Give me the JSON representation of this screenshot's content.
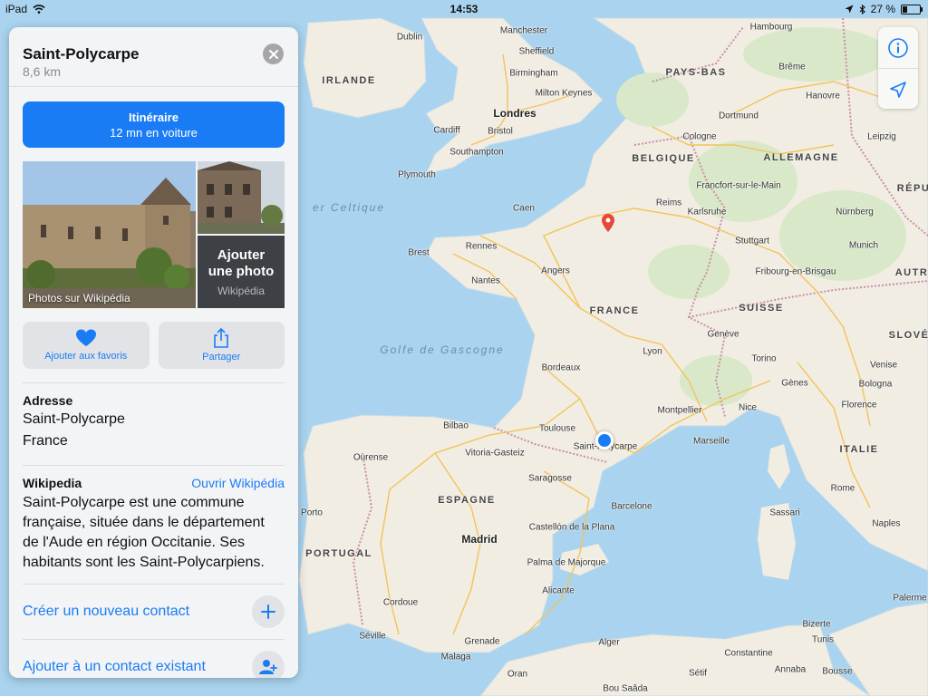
{
  "status_bar": {
    "device": "iPad",
    "time": "14:53",
    "battery_text": "27 %",
    "battery_level": 0.27
  },
  "map": {
    "seas": [
      "er Celtique",
      "Golfe de Gascogne"
    ],
    "countries": [
      "IRLANDE",
      "PAYS-BAS",
      "BELGIQUE",
      "ALLEMAGNE",
      "FRANCE",
      "SUISSE",
      "ESPAGNE",
      "PORTUGAL",
      "ITALIE",
      "RÉPU",
      "AUTR",
      "SLOVÉ"
    ],
    "cities": [
      "Dublin",
      "Manchester",
      "Sheffield",
      "Birmingham",
      "Milton Keynes",
      "Londres",
      "Cardiff",
      "Bristol",
      "Southampton",
      "Plymouth",
      "Hambourg",
      "Brême",
      "Hanovre",
      "Dortmund",
      "Leipzig",
      "Cologne",
      "Francfort-sur-le-Main",
      "Nürnberg",
      "Karlsruhe",
      "Stuttgart",
      "Munich",
      "Fribourg-en-Brisgau",
      "Caen",
      "Reims",
      "Rennes",
      "Brest",
      "Angers",
      "Nantes",
      "Genève",
      "Lyon",
      "Bordeaux",
      "Torino",
      "Gènes",
      "Venise",
      "Bologna",
      "Florence",
      "Nice",
      "Montpellier",
      "Marseille",
      "Toulouse",
      "Saint-Polycarpe",
      "Bilbao",
      "Vitoria-Gasteiz",
      "Ourense",
      "Saragosse",
      "Barcelone",
      "Porto",
      "Madrid",
      "Castellón de la Plana",
      "Palma de Majorque",
      "Sassari",
      "Rome",
      "Naples",
      "Alicante",
      "Cordoue",
      "Séville",
      "Malaga",
      "Grenade",
      "Alger",
      "Constantine",
      "Bizerte",
      "Tunis",
      "Palerme",
      "Annaba",
      "Sétif",
      "Bousse",
      "Oran",
      "Bou Saâda"
    ],
    "colors": {
      "water": "#a9d3ee",
      "land": "#f1ede2",
      "forest": "#d9e8c8",
      "road": "#f3c35a",
      "border": "#c98fa8"
    }
  },
  "map_controls": {
    "info_icon": "info-icon",
    "location_icon": "location-arrow-icon"
  },
  "card": {
    "title": "Saint-Polycarpe",
    "distance": "8,6 km",
    "route": {
      "title": "Itinéraire",
      "subtitle": "12 mn en voiture"
    },
    "photos": {
      "caption": "Photos sur Wikipédia",
      "add_label": "Ajouter une photo",
      "add_source": "Wikipédia"
    },
    "actions": {
      "favorite": "Ajouter aux favoris",
      "share": "Partager"
    },
    "address": {
      "title": "Adresse",
      "line1": "Saint-Polycarpe",
      "line2": "France"
    },
    "wikipedia": {
      "title": "Wikipedia",
      "link": "Ouvrir Wikipédia",
      "text": "Saint-Polycarpe est une commune française, située dans le département de l'Aude en région Occitanie. Ses habitants sont les Saint-Polycarpiens."
    },
    "contacts": {
      "new": "Créer un nouveau contact",
      "existing": "Ajouter à un contact existant"
    }
  }
}
